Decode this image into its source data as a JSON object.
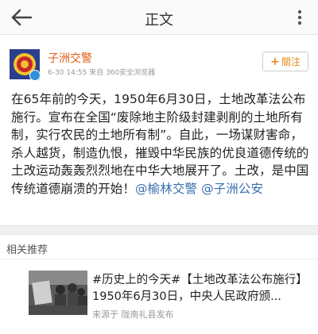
{
  "header": {
    "title": "正文",
    "back_icon": "back-arrow-icon",
    "more_icon": "more-vertical-icon"
  },
  "post": {
    "author_name": "子洲交警",
    "meta": "6-30 14:55  来自 360安全浏览器",
    "follow_label": "關注",
    "content_parts": [
      "在65年前的今天，1950年6月30日，土地改革法公布施行。宣布在全国“废除地主阶级封建剥削的土地所有制，实行农民的土地所有制”。自此，一场谋财害命，杀人越货，制造仇恨，摧毁中华民族的优良道德传统的土改运动轰轰烈烈地在中华大地展开了。土改，是中国传统道德崩溃的开始！",
      "@榆林交警",
      " ",
      "@子洲公安"
    ]
  },
  "related": {
    "section_title": "相关推荐",
    "item_title": "#历史上的今天#【土地改革法公布施行】1950年6月30日，中央人民政府颁...",
    "item_source": "来源于 陇南礼县发布"
  },
  "colors": {
    "author_name": "#e25c11",
    "follow_text": "#e88a1f",
    "mention": "#3a6fb0",
    "verified_badge": "#2f8fe0"
  }
}
